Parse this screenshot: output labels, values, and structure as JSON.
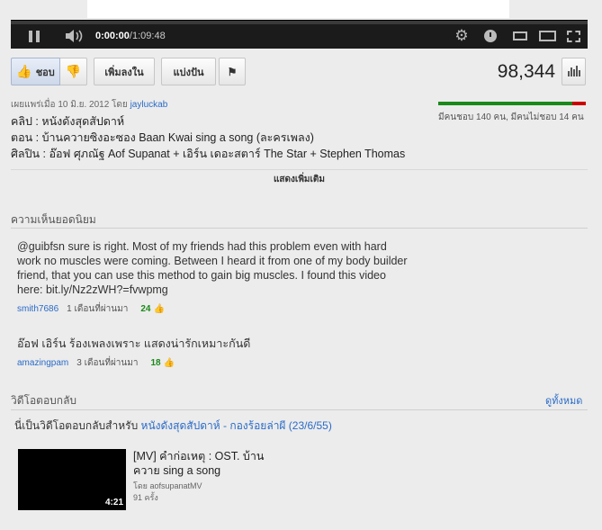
{
  "player": {
    "current_time": "0:00:00",
    "separator": " / ",
    "duration": "1:09:48",
    "played_fraction": 0
  },
  "actions": {
    "like_label": "ชอบ",
    "add_label": "เพิ่มลงใน",
    "share_label": "แบ่งปัน",
    "view_count": "98,344"
  },
  "video_info": {
    "published_prefix": "เผยแพร่เมื่อ 10 มิ.ย. 2012 โดย ",
    "uploader": "jayluckab",
    "description_lines": [
      "คลิป : หนังดังสุดสัปดาห์",
      "ตอน : บ้านควายซิงอะซอง Baan Kwai sing a song (ละครเพลง)",
      "ศิลปิน : อ๊อฟ ศุภณัฐ Aof Supanat + เอิร์น เดอะสตาร์ The Star + Stephen Thomas"
    ],
    "show_more": "แสดงเพิ่มเติม"
  },
  "ratings": {
    "like_fraction": 0.909,
    "text": "มีคนชอบ 140 คน, มีคนไม่ชอบ 14 คน"
  },
  "top_comments": {
    "title": "ความเห็นยอดนิยม",
    "items": [
      {
        "text": "@guibfsn sure is right. Most of my friends had this problem even with hard work no muscles were coming. Between I heard it from one of my body builder friend, that you can use this method to gain big muscles. I found this video here: bit.ly/Nz2zWH?=fvwpmg",
        "user": "smith7686",
        "time": "1 เดือนที่ผ่านมา",
        "votes": "24"
      },
      {
        "text": "อ๊อฟ เอิร์น ร้องเพลงเพราะ แสดงน่ารักเหมาะกันดี",
        "user": "amazingpam",
        "time": "3 เดือนที่ผ่านมา",
        "votes": "18"
      }
    ]
  },
  "video_responses": {
    "title": "วิดีโอตอบกลับ",
    "see_all": "ดูทั้งหมด",
    "note_prefix": "นี่เป็นวิดีโอตอบกลับสำหรับ ",
    "note_link": "หนังดังสุดสัปดาห์ - กองร้อยล่าผี (23/6/55)",
    "item": {
      "title": "[MV] คำก่อเหตุ : OST. บ้านควาย sing a song",
      "by": "โดย aofsupanatMV",
      "views": "91 ครั้ง",
      "duration": "4:21"
    }
  },
  "colors": {
    "link": "#2a6bc7",
    "like_bar": "#1a8a1a",
    "dislike_bar": "#cc0000",
    "vote_count": "#1a8a1a"
  }
}
